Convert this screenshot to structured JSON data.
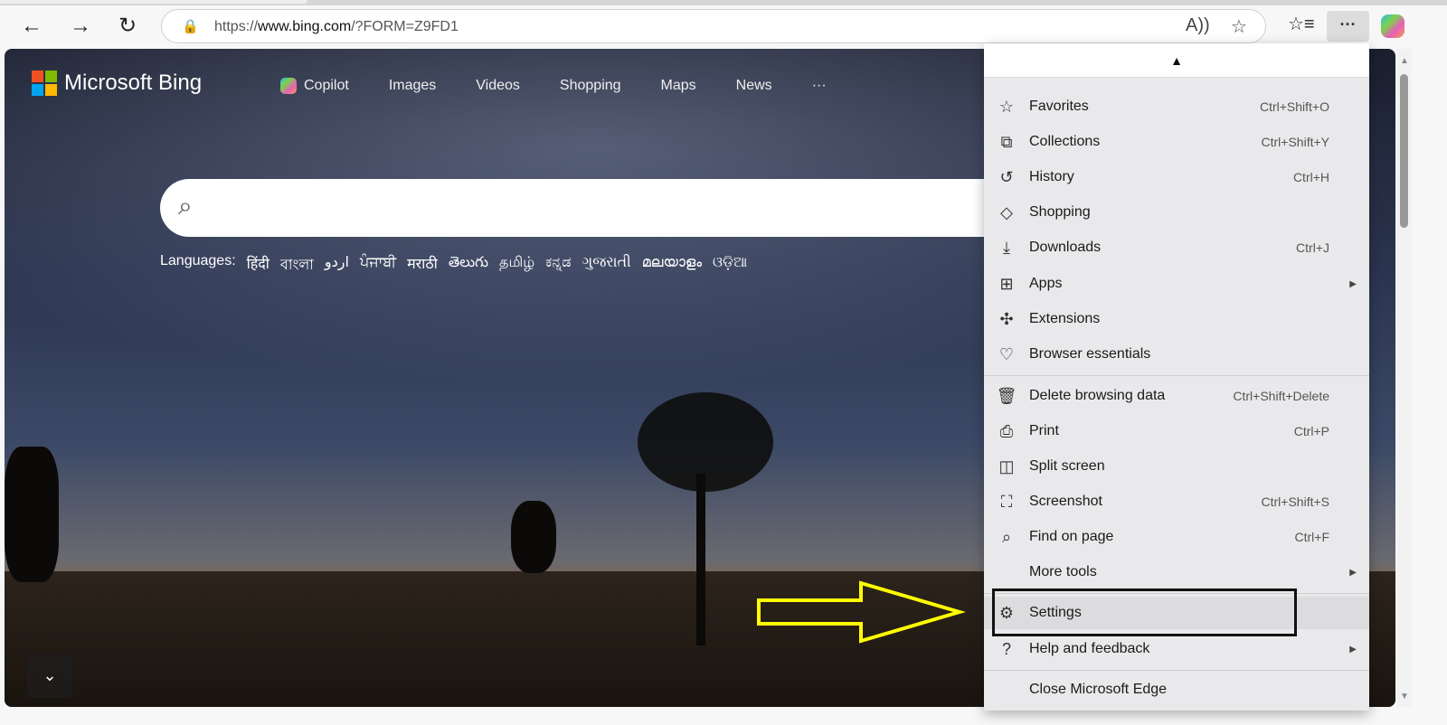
{
  "browser": {
    "url_prefix": "https://",
    "url_domain": "www.bing.com",
    "url_rest": "/?FORM=Z9FD1"
  },
  "bing": {
    "logo_text": "Microsoft Bing",
    "nav": [
      "Copilot",
      "Images",
      "Videos",
      "Shopping",
      "Maps",
      "News",
      "···"
    ],
    "languages_label": "Languages:",
    "languages": [
      "हिंदी",
      "বাংলা",
      "اردو",
      "ਪੰਜਾਬੀ",
      "मराठी",
      "తెలుగు",
      "தமிழ்",
      "ಕನ್ನಡ",
      "ગુજરાતી",
      "മലയാളം",
      "ଓଡ଼ିଆ"
    ]
  },
  "menu": {
    "items": [
      {
        "label": "Favorites",
        "shortcut": "Ctrl+Shift+O",
        "icon": "☆"
      },
      {
        "label": "Collections",
        "shortcut": "Ctrl+Shift+Y",
        "icon": "⧉"
      },
      {
        "label": "History",
        "shortcut": "Ctrl+H",
        "icon": "↺"
      },
      {
        "label": "Shopping",
        "shortcut": "",
        "icon": "◇"
      },
      {
        "label": "Downloads",
        "shortcut": "Ctrl+J",
        "icon": "⤓"
      },
      {
        "label": "Apps",
        "shortcut": "",
        "icon": "⊞",
        "submenu": true
      },
      {
        "label": "Extensions",
        "shortcut": "",
        "icon": "✣"
      },
      {
        "label": "Browser essentials",
        "shortcut": "",
        "icon": "♡"
      },
      {
        "label": "Delete browsing data",
        "shortcut": "Ctrl+Shift+Delete",
        "icon": "🗑"
      },
      {
        "label": "Print",
        "shortcut": "Ctrl+P",
        "icon": "⎙"
      },
      {
        "label": "Split screen",
        "shortcut": "",
        "icon": "◫"
      },
      {
        "label": "Screenshot",
        "shortcut": "Ctrl+Shift+S",
        "icon": "⛶"
      },
      {
        "label": "Find on page",
        "shortcut": "Ctrl+F",
        "icon": "⌕"
      },
      {
        "label": "More tools",
        "shortcut": "",
        "icon": "",
        "submenu": true
      },
      {
        "label": "Settings",
        "shortcut": "",
        "icon": "⚙"
      },
      {
        "label": "Help and feedback",
        "shortcut": "",
        "icon": "?",
        "submenu": true
      },
      {
        "label": "Close Microsoft Edge",
        "shortcut": "",
        "icon": ""
      }
    ]
  },
  "colors": {
    "highlight_arrow": "#ffff00"
  }
}
